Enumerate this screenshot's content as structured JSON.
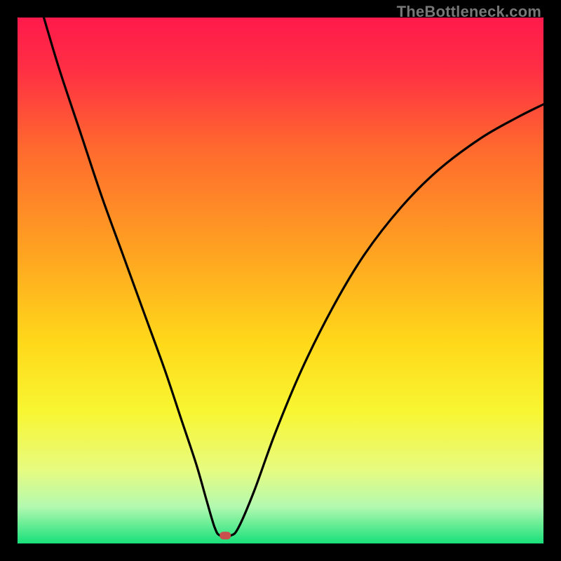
{
  "watermark": "TheBottleneck.com",
  "chart_data": {
    "type": "line",
    "title": "",
    "xlabel": "",
    "ylabel": "",
    "xlim": [
      0,
      100
    ],
    "ylim": [
      0,
      100
    ],
    "grid": false,
    "legend": false,
    "background_gradient_stops": [
      {
        "pos": 0.0,
        "color": "#ff1a4b"
      },
      {
        "pos": 0.1,
        "color": "#ff2f44"
      },
      {
        "pos": 0.25,
        "color": "#ff6a2e"
      },
      {
        "pos": 0.45,
        "color": "#ffa421"
      },
      {
        "pos": 0.62,
        "color": "#ffd91a"
      },
      {
        "pos": 0.75,
        "color": "#f8f632"
      },
      {
        "pos": 0.86,
        "color": "#e7fb80"
      },
      {
        "pos": 0.93,
        "color": "#b3f9b0"
      },
      {
        "pos": 1.0,
        "color": "#18e07a"
      }
    ],
    "marker": {
      "x": 39.5,
      "y": 1.5,
      "color": "#c9504c"
    },
    "series": [
      {
        "name": "curve",
        "color": "#000000",
        "points": [
          {
            "x": 5.0,
            "y": 100.0
          },
          {
            "x": 8.0,
            "y": 90.0
          },
          {
            "x": 12.0,
            "y": 78.0
          },
          {
            "x": 16.0,
            "y": 66.0
          },
          {
            "x": 20.0,
            "y": 55.0
          },
          {
            "x": 24.0,
            "y": 44.0
          },
          {
            "x": 28.0,
            "y": 33.0
          },
          {
            "x": 31.0,
            "y": 24.0
          },
          {
            "x": 34.0,
            "y": 15.0
          },
          {
            "x": 36.0,
            "y": 8.0
          },
          {
            "x": 37.5,
            "y": 3.0
          },
          {
            "x": 38.5,
            "y": 1.5
          },
          {
            "x": 40.5,
            "y": 1.5
          },
          {
            "x": 42.0,
            "y": 3.0
          },
          {
            "x": 45.0,
            "y": 10.0
          },
          {
            "x": 49.0,
            "y": 21.0
          },
          {
            "x": 54.0,
            "y": 33.0
          },
          {
            "x": 60.0,
            "y": 45.0
          },
          {
            "x": 66.0,
            "y": 55.0
          },
          {
            "x": 73.0,
            "y": 64.0
          },
          {
            "x": 80.0,
            "y": 71.0
          },
          {
            "x": 88.0,
            "y": 77.0
          },
          {
            "x": 95.0,
            "y": 81.0
          },
          {
            "x": 100.0,
            "y": 83.5
          }
        ]
      }
    ]
  }
}
